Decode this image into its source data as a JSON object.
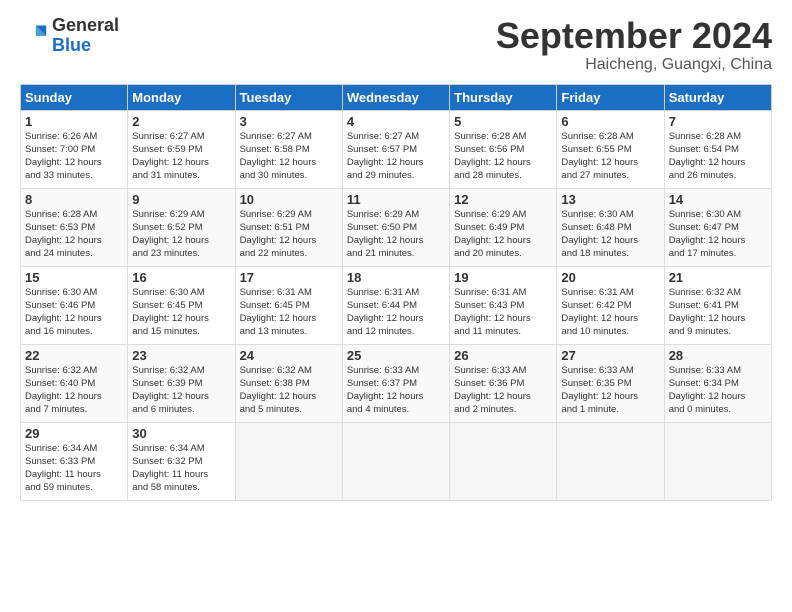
{
  "header": {
    "logo_general": "General",
    "logo_blue": "Blue",
    "month_title": "September 2024",
    "location": "Haicheng, Guangxi, China"
  },
  "days_of_week": [
    "Sunday",
    "Monday",
    "Tuesday",
    "Wednesday",
    "Thursday",
    "Friday",
    "Saturday"
  ],
  "weeks": [
    [
      {
        "num": "1",
        "info": "Sunrise: 6:26 AM\nSunset: 7:00 PM\nDaylight: 12 hours\nand 33 minutes."
      },
      {
        "num": "2",
        "info": "Sunrise: 6:27 AM\nSunset: 6:59 PM\nDaylight: 12 hours\nand 31 minutes."
      },
      {
        "num": "3",
        "info": "Sunrise: 6:27 AM\nSunset: 6:58 PM\nDaylight: 12 hours\nand 30 minutes."
      },
      {
        "num": "4",
        "info": "Sunrise: 6:27 AM\nSunset: 6:57 PM\nDaylight: 12 hours\nand 29 minutes."
      },
      {
        "num": "5",
        "info": "Sunrise: 6:28 AM\nSunset: 6:56 PM\nDaylight: 12 hours\nand 28 minutes."
      },
      {
        "num": "6",
        "info": "Sunrise: 6:28 AM\nSunset: 6:55 PM\nDaylight: 12 hours\nand 27 minutes."
      },
      {
        "num": "7",
        "info": "Sunrise: 6:28 AM\nSunset: 6:54 PM\nDaylight: 12 hours\nand 26 minutes."
      }
    ],
    [
      {
        "num": "8",
        "info": "Sunrise: 6:28 AM\nSunset: 6:53 PM\nDaylight: 12 hours\nand 24 minutes."
      },
      {
        "num": "9",
        "info": "Sunrise: 6:29 AM\nSunset: 6:52 PM\nDaylight: 12 hours\nand 23 minutes."
      },
      {
        "num": "10",
        "info": "Sunrise: 6:29 AM\nSunset: 6:51 PM\nDaylight: 12 hours\nand 22 minutes."
      },
      {
        "num": "11",
        "info": "Sunrise: 6:29 AM\nSunset: 6:50 PM\nDaylight: 12 hours\nand 21 minutes."
      },
      {
        "num": "12",
        "info": "Sunrise: 6:29 AM\nSunset: 6:49 PM\nDaylight: 12 hours\nand 20 minutes."
      },
      {
        "num": "13",
        "info": "Sunrise: 6:30 AM\nSunset: 6:48 PM\nDaylight: 12 hours\nand 18 minutes."
      },
      {
        "num": "14",
        "info": "Sunrise: 6:30 AM\nSunset: 6:47 PM\nDaylight: 12 hours\nand 17 minutes."
      }
    ],
    [
      {
        "num": "15",
        "info": "Sunrise: 6:30 AM\nSunset: 6:46 PM\nDaylight: 12 hours\nand 16 minutes."
      },
      {
        "num": "16",
        "info": "Sunrise: 6:30 AM\nSunset: 6:45 PM\nDaylight: 12 hours\nand 15 minutes."
      },
      {
        "num": "17",
        "info": "Sunrise: 6:31 AM\nSunset: 6:45 PM\nDaylight: 12 hours\nand 13 minutes."
      },
      {
        "num": "18",
        "info": "Sunrise: 6:31 AM\nSunset: 6:44 PM\nDaylight: 12 hours\nand 12 minutes."
      },
      {
        "num": "19",
        "info": "Sunrise: 6:31 AM\nSunset: 6:43 PM\nDaylight: 12 hours\nand 11 minutes."
      },
      {
        "num": "20",
        "info": "Sunrise: 6:31 AM\nSunset: 6:42 PM\nDaylight: 12 hours\nand 10 minutes."
      },
      {
        "num": "21",
        "info": "Sunrise: 6:32 AM\nSunset: 6:41 PM\nDaylight: 12 hours\nand 9 minutes."
      }
    ],
    [
      {
        "num": "22",
        "info": "Sunrise: 6:32 AM\nSunset: 6:40 PM\nDaylight: 12 hours\nand 7 minutes."
      },
      {
        "num": "23",
        "info": "Sunrise: 6:32 AM\nSunset: 6:39 PM\nDaylight: 12 hours\nand 6 minutes."
      },
      {
        "num": "24",
        "info": "Sunrise: 6:32 AM\nSunset: 6:38 PM\nDaylight: 12 hours\nand 5 minutes."
      },
      {
        "num": "25",
        "info": "Sunrise: 6:33 AM\nSunset: 6:37 PM\nDaylight: 12 hours\nand 4 minutes."
      },
      {
        "num": "26",
        "info": "Sunrise: 6:33 AM\nSunset: 6:36 PM\nDaylight: 12 hours\nand 2 minutes."
      },
      {
        "num": "27",
        "info": "Sunrise: 6:33 AM\nSunset: 6:35 PM\nDaylight: 12 hours\nand 1 minute."
      },
      {
        "num": "28",
        "info": "Sunrise: 6:33 AM\nSunset: 6:34 PM\nDaylight: 12 hours\nand 0 minutes."
      }
    ],
    [
      {
        "num": "29",
        "info": "Sunrise: 6:34 AM\nSunset: 6:33 PM\nDaylight: 11 hours\nand 59 minutes."
      },
      {
        "num": "30",
        "info": "Sunrise: 6:34 AM\nSunset: 6:32 PM\nDaylight: 11 hours\nand 58 minutes."
      },
      null,
      null,
      null,
      null,
      null
    ]
  ]
}
